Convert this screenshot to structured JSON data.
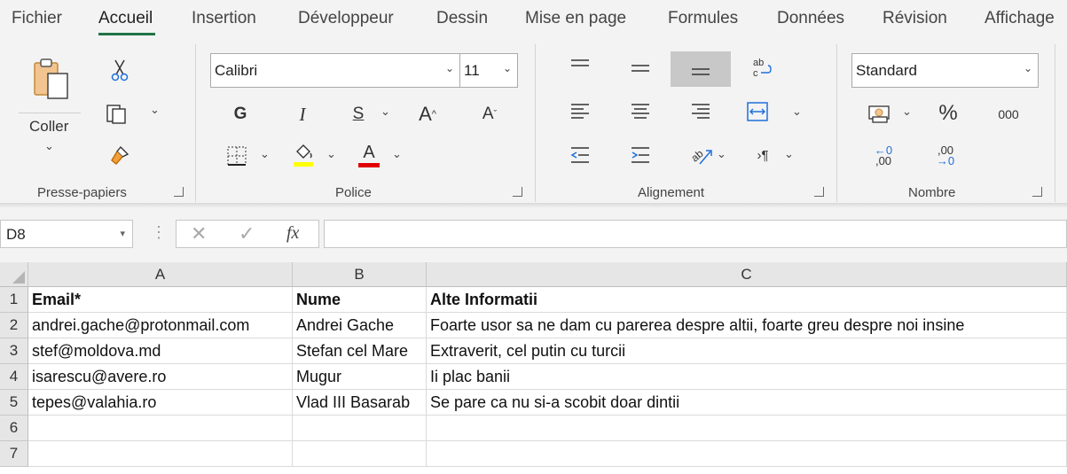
{
  "tabs": [
    "Fichier",
    "Accueil",
    "Insertion",
    "Développeur",
    "Dessin",
    "Mise en page",
    "Formules",
    "Données",
    "Révision",
    "Affichage"
  ],
  "active_tab": "Accueil",
  "ribbon": {
    "clipboard": {
      "paste_label": "Coller",
      "group_label": "Presse-papiers"
    },
    "font": {
      "font_name": "Calibri",
      "font_size": "11",
      "bold": "G",
      "italic": "I",
      "underline": "S",
      "grow": "A",
      "shrink": "A",
      "font_color_letter": "A",
      "group_label": "Police",
      "highlight_color": "#ffff00",
      "font_color": "#e00000"
    },
    "alignment": {
      "group_label": "Alignement"
    },
    "number": {
      "format": "Standard",
      "percent": "%",
      "thousands": "000",
      "inc_decimal": ",00",
      "dec_decimal": ",00",
      "group_label": "Nombre"
    }
  },
  "formula_bar": {
    "name_box": "D8",
    "formula": ""
  },
  "columns": [
    "A",
    "B",
    "C"
  ],
  "rows": [
    "1",
    "2",
    "3",
    "4",
    "5",
    "6",
    "7"
  ],
  "cells": [
    [
      "Email*",
      "Nume",
      "Alte Informatii"
    ],
    [
      "andrei.gache@protonmail.com",
      "Andrei Gache",
      "Foarte usor sa ne dam cu parerea despre altii, foarte greu despre noi insine"
    ],
    [
      "stef@moldova.md",
      "Stefan cel Mare",
      "Extraverit, cel putin cu turcii"
    ],
    [
      "isarescu@avere.ro",
      "Mugur",
      "Ii plac banii"
    ],
    [
      "tepes@valahia.ro",
      "Vlad III Basarab",
      "Se pare ca nu si-a scobit doar dintii"
    ],
    [
      "",
      "",
      ""
    ],
    [
      "",
      "",
      ""
    ]
  ],
  "colors": {
    "accent": "#217346"
  }
}
